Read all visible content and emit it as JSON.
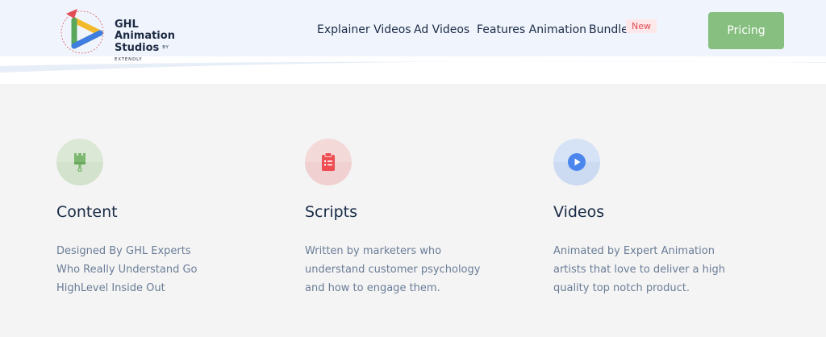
{
  "brand": {
    "name_line1": "GHL Animation",
    "name_line2": "Studios",
    "by_line": "BY EXTENDLY"
  },
  "nav": {
    "items": [
      {
        "label": "Explainer Videos"
      },
      {
        "label": "Ad Videos"
      },
      {
        "label": "Features Animation"
      },
      {
        "label": "Bundle"
      }
    ],
    "badge": "New",
    "cta": "Pricing"
  },
  "colors": {
    "header_bg": "#f0f5fd",
    "section_bg": "#f4f4f4",
    "cta_bg": "#86bf7f",
    "badge_bg": "#fde7e9",
    "badge_text": "#e34b55",
    "heading": "#182a45",
    "body_text": "#6a7d97"
  },
  "features": [
    {
      "icon": "paint-brush-icon",
      "title": "Content",
      "description_lines": [
        "Designed By GHL Experts",
        "Who Really Understand Go",
        "HighLevel Inside Out"
      ],
      "icon_color": "#7cb86f",
      "circle_color": "#dbe8d6"
    },
    {
      "icon": "clipboard-list-icon",
      "title": "Scripts",
      "description_lines": [
        "Written by marketers who",
        "understand customer psychology",
        "and how to engage them."
      ],
      "icon_color": "#ee4d52",
      "circle_color": "#f4d9d9"
    },
    {
      "icon": "play-circle-icon",
      "title": "Videos",
      "description_lines": [
        "Animated by Expert Animation",
        "artists that love to deliver a high",
        "quality top notch product."
      ],
      "icon_color": "#4b86ee",
      "circle_color": "#d6e2f6"
    }
  ]
}
